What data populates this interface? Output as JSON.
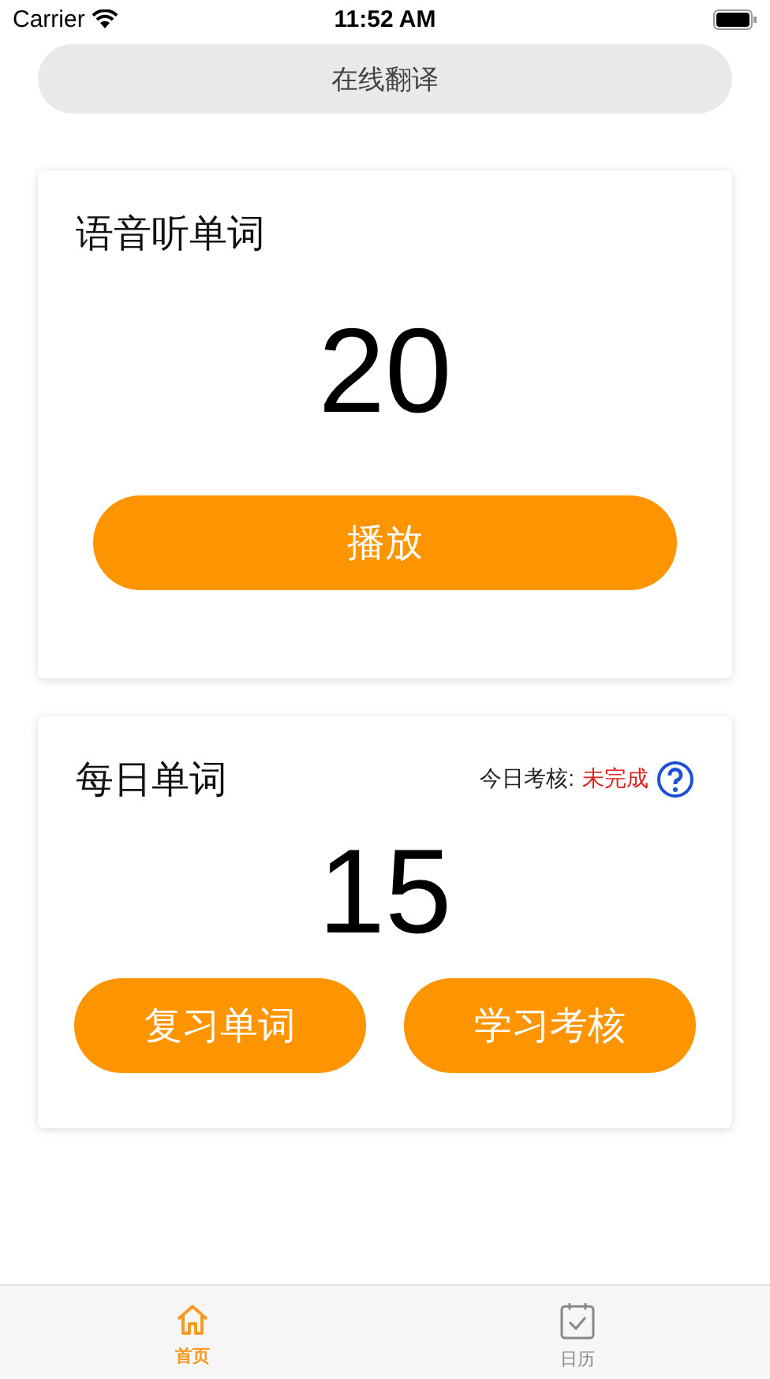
{
  "status_bar": {
    "carrier": "Carrier",
    "time": "11:52 AM"
  },
  "translate_button": {
    "label": "在线翻译"
  },
  "listen_card": {
    "title": "语音听单词",
    "count": "20",
    "button": "播放"
  },
  "daily_card": {
    "title": "每日单词",
    "check_label": "今日考核:",
    "check_status": "未完成",
    "count": "15",
    "buttons": [
      "复习单词",
      "学习考核"
    ]
  },
  "tab_bar": [
    {
      "kind": "home",
      "label": "首页",
      "selected": true
    },
    {
      "kind": "calendar",
      "label": "日历",
      "selected": false
    }
  ]
}
